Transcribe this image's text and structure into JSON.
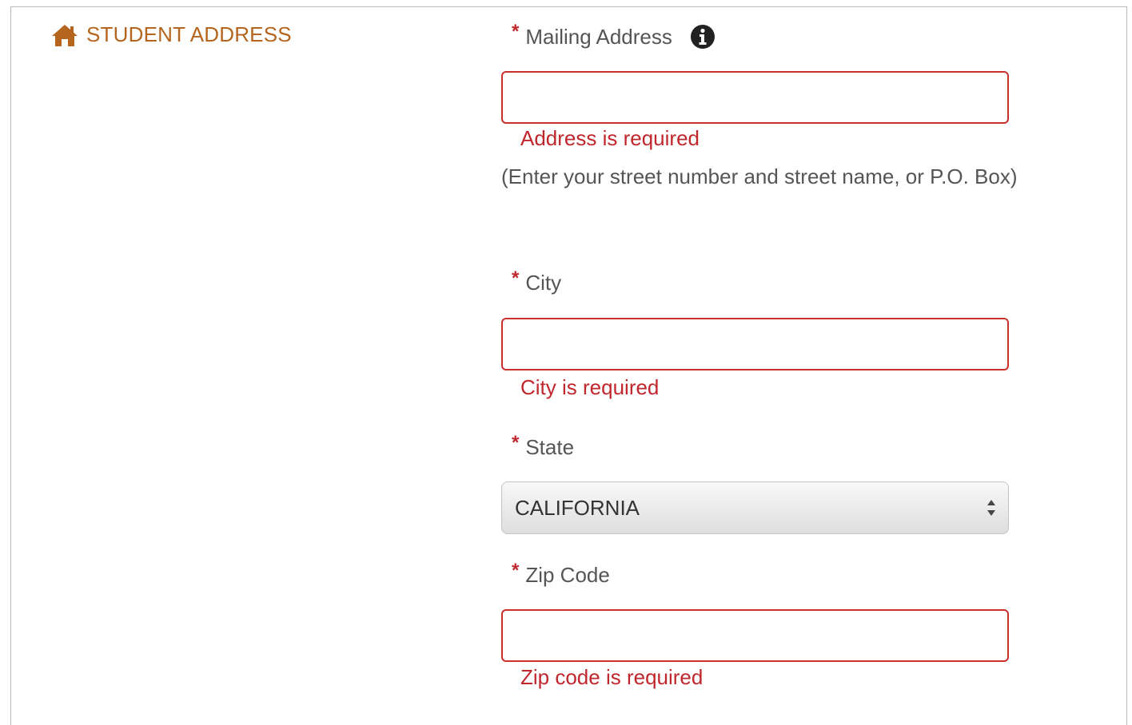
{
  "section": {
    "title": "STUDENT ADDRESS",
    "icon": "home-icon",
    "color": "#b5651d"
  },
  "required_marker": "*",
  "mailing": {
    "label": "Mailing Address",
    "info_icon": "info-icon",
    "value": "",
    "error": "Address is required",
    "hint": "(Enter your street number and street name, or P.O. Box)"
  },
  "city": {
    "label": "City",
    "value": "",
    "error": "City is required"
  },
  "state": {
    "label": "State",
    "selected": "CALIFORNIA"
  },
  "zip": {
    "label": "Zip Code",
    "value": "",
    "error": "Zip code is required"
  },
  "colors": {
    "error": "#c0272d",
    "label": "#555555"
  }
}
